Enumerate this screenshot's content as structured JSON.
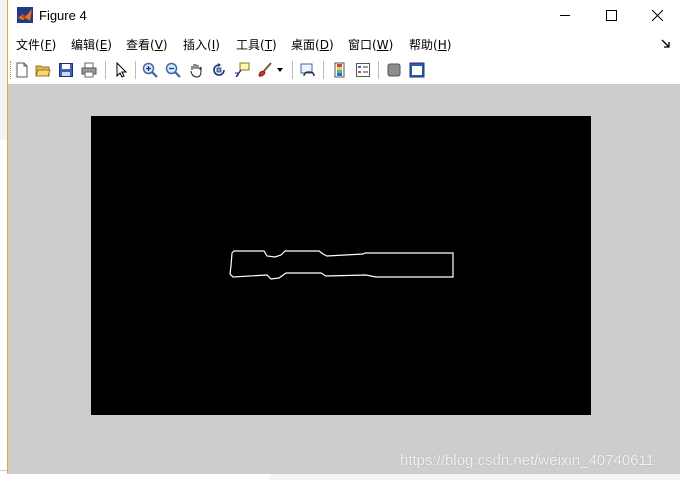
{
  "window": {
    "title": "Figure 4",
    "controls": {
      "minimize": "minimize",
      "maximize": "maximize",
      "close": "close"
    }
  },
  "menu": {
    "items": [
      {
        "label": "文件(",
        "key": "F",
        "end": ")"
      },
      {
        "label": "编辑(",
        "key": "E",
        "end": ")"
      },
      {
        "label": "查看(",
        "key": "V",
        "end": ")"
      },
      {
        "label": "插入(",
        "key": "I",
        "end": ")"
      },
      {
        "label": "工具(",
        "key": "T",
        "end": ")"
      },
      {
        "label": "桌面(",
        "key": "D",
        "end": ")"
      },
      {
        "label": "窗口(",
        "key": "W",
        "end": ")"
      },
      {
        "label": "帮助(",
        "key": "H",
        "end": ")"
      }
    ]
  },
  "toolbar": {
    "buttons": [
      "new-figure-icon",
      "open-file-icon",
      "save-icon",
      "print-icon",
      "edit-plot-arrow-icon",
      "zoom-in-icon",
      "zoom-out-icon",
      "pan-hand-icon",
      "rotate-3d-icon",
      "data-cursor-icon",
      "brush-icon",
      "brush-dropdown-icon",
      "link-plot-icon",
      "insert-colorbar-icon",
      "insert-legend-icon",
      "hide-plot-tools-icon",
      "show-plot-tools-icon"
    ]
  },
  "figure": {
    "axes_background": "#000000",
    "canvas_background": "#cdcdcd",
    "contour_color": "#ffffff"
  },
  "watermark": "https://blog.csdn.net/weixin_40740611",
  "colors": {
    "window_border": "#e0a93f"
  }
}
